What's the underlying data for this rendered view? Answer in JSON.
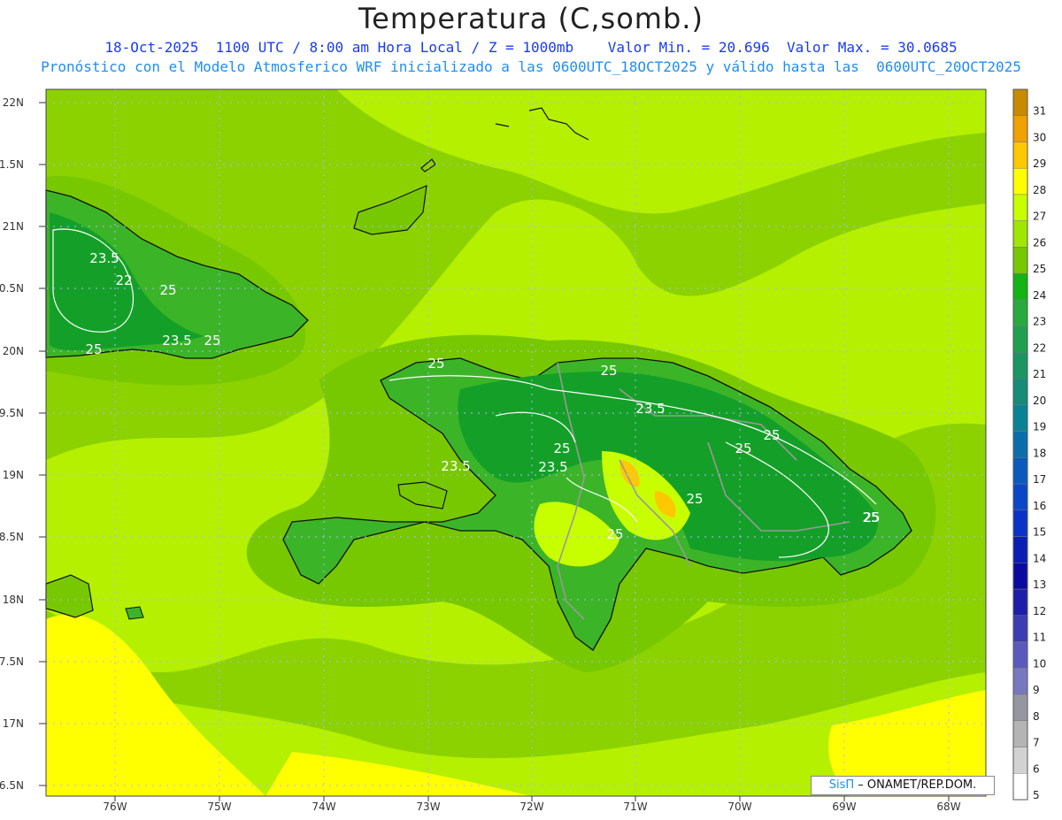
{
  "title": "Temperatura (C,somb.)",
  "subtitle_line1": "18-Oct-2025  1100 UTC / 8:00 am Hora Local / Z = 1000mb    Valor Min. = 20.696  Valor Max. = 30.0685",
  "subtitle_line2": "Pronóstico con el Modelo Atmosferico WRF inicializado a las 0600UTC_18OCT2025 y válido hasta las  0600UTC_20OCT2025",
  "credit": {
    "brand": "SisΠ",
    "text": "– ONAMET/REP.DOM."
  },
  "lat_labels": [
    "22N",
    "21.5N",
    "21N",
    "20.5N",
    "20N",
    "19.5N",
    "19N",
    "18.5N",
    "18N",
    "17.5N",
    "17N",
    "16.5N"
  ],
  "lon_labels": [
    "76W",
    "75W",
    "74W",
    "73W",
    "72W",
    "71W",
    "70W",
    "69W",
    "68W"
  ],
  "contour_labels": [
    "23.5",
    "22",
    "25",
    "23.5",
    "25",
    "25",
    "25",
    "25",
    "23.5",
    "25",
    "25",
    "23.5",
    "23.5",
    "25",
    "25",
    "25",
    "25",
    "25"
  ],
  "colorbar": {
    "levels": [
      "31",
      "30",
      "29",
      "28",
      "27",
      "26",
      "25",
      "24",
      "23",
      "22",
      "21",
      "20",
      "19",
      "18",
      "17",
      "16",
      "15",
      "14",
      "13",
      "12",
      "11",
      "10",
      "9",
      "8",
      "7",
      "6",
      "5"
    ],
    "colors": [
      "#c88a00",
      "#f0a000",
      "#ffc800",
      "#ffff00",
      "#c8ff00",
      "#a0e600",
      "#78c800",
      "#14b414",
      "#28aa3c",
      "#1ea050",
      "#199664",
      "#148c78",
      "#0a8296",
      "#0a6eaa",
      "#0a5abe",
      "#0a46c8",
      "#0a32c8",
      "#0a1eb4",
      "#0a0aa0",
      "#1e1eaa",
      "#3c3cb4",
      "#5a5abe",
      "#7878c0",
      "#9696a0",
      "#b4b4b4",
      "#d2d2d2",
      "#ffffff"
    ]
  },
  "colors": {
    "ocean": "#8cd200",
    "ocean_light": "#b4f000",
    "warm": "#ffff00",
    "land_cool": "#14a028",
    "land_mid": "#3cb428",
    "coast": "#111111",
    "border": "#999999",
    "contour": "#ffffff"
  }
}
